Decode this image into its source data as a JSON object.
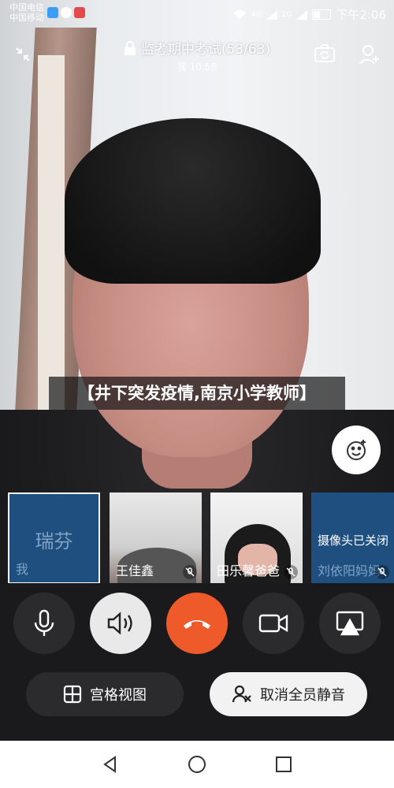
{
  "status_bar": {
    "carrier_1": "中国电信",
    "carrier_2": "中国移动",
    "signal_1": "4G",
    "signal_2": "2G",
    "time": "下午2:06"
  },
  "call": {
    "title": "监考期中考试(53/63)",
    "self_time": "我 10:58"
  },
  "caption": "【井下突发疫情,南京小学教师】",
  "participants": [
    {
      "name": "我",
      "avatar_text": "瑞芬",
      "mic_muted": false
    },
    {
      "name": "王佳鑫",
      "mic_muted": true
    },
    {
      "name": "田乐馨爸爸",
      "mic_muted": true
    },
    {
      "name": "刘依阳妈妈",
      "status_text": "摄像头已关闭",
      "mic_muted": true
    }
  ],
  "controls": {
    "grid_view_label": "宫格视图",
    "mute_all_cancel_label": "取消全员静音"
  },
  "colors": {
    "hangup": "#ef5a2a",
    "thumb_blue": "#1f4f7f",
    "selected_border": "#ffffff"
  }
}
